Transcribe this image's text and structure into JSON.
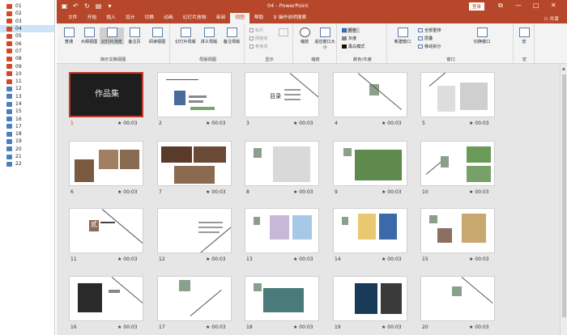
{
  "file_list": {
    "items": [
      {
        "label": "01",
        "type": "ppt"
      },
      {
        "label": "02",
        "type": "ppt"
      },
      {
        "label": "03",
        "type": "ppt"
      },
      {
        "label": "04",
        "type": "ppt",
        "selected": true
      },
      {
        "label": "05",
        "type": "ppt"
      },
      {
        "label": "06",
        "type": "ppt"
      },
      {
        "label": "07",
        "type": "ppt"
      },
      {
        "label": "08",
        "type": "ppt"
      },
      {
        "label": "09",
        "type": "ppt"
      },
      {
        "label": "10",
        "type": "ppt"
      },
      {
        "label": "11",
        "type": "ppt"
      },
      {
        "label": "12",
        "type": "img"
      },
      {
        "label": "13",
        "type": "img"
      },
      {
        "label": "14",
        "type": "img"
      },
      {
        "label": "15",
        "type": "img"
      },
      {
        "label": "16",
        "type": "img"
      },
      {
        "label": "17",
        "type": "img"
      },
      {
        "label": "18",
        "type": "img"
      },
      {
        "label": "19",
        "type": "img"
      },
      {
        "label": "20",
        "type": "img"
      },
      {
        "label": "21",
        "type": "img"
      },
      {
        "label": "22",
        "type": "img"
      }
    ]
  },
  "titlebar": {
    "title": "04 - PowerPoint",
    "login": "登录",
    "minimize": "—",
    "maximize": "□",
    "close": "✕",
    "ribbon_toggle": "⧉"
  },
  "tabs": [
    {
      "label": "文件"
    },
    {
      "label": "开始"
    },
    {
      "label": "插入"
    },
    {
      "label": "设计"
    },
    {
      "label": "切换"
    },
    {
      "label": "动画"
    },
    {
      "label": "幻灯片放映"
    },
    {
      "label": "审阅"
    },
    {
      "label": "视图",
      "active": true
    },
    {
      "label": "帮助"
    }
  ],
  "tell_me": "操作说明搜索",
  "share": "共享",
  "ribbon": {
    "presentation_views": {
      "label": "演示文稿视图",
      "buttons": [
        "普通",
        "大纲视图",
        "幻灯片浏览",
        "备注页",
        "阅读视图"
      ]
    },
    "master_views": {
      "label": "母版视图",
      "buttons": [
        "幻灯片母版",
        "讲义母版",
        "备注母版"
      ]
    },
    "show": {
      "label": "显示",
      "items": [
        "标尺",
        "网格线",
        "参考线"
      ]
    },
    "zoom": {
      "label": "缩放",
      "buttons": [
        "缩放",
        "适应窗口大小"
      ]
    },
    "color": {
      "label": "颜色/灰度",
      "items": [
        "颜色",
        "灰度",
        "黑白模式"
      ]
    },
    "window": {
      "label": "窗口",
      "items": [
        "新建窗口",
        "全部重排",
        "层叠",
        "移动拆分",
        "切换窗口"
      ]
    },
    "macro": {
      "label": "宏",
      "buttons": [
        "宏"
      ]
    }
  },
  "slides": [
    {
      "num": "1",
      "time": "00:03",
      "title": "作品集"
    },
    {
      "num": "2",
      "time": "00:03"
    },
    {
      "num": "3",
      "time": "00:03",
      "title": "目录"
    },
    {
      "num": "4",
      "time": "00:03"
    },
    {
      "num": "5",
      "time": "00:03"
    },
    {
      "num": "6",
      "time": "00:03"
    },
    {
      "num": "7",
      "time": "00:03"
    },
    {
      "num": "8",
      "time": "00:03"
    },
    {
      "num": "9",
      "time": "00:03"
    },
    {
      "num": "10",
      "time": "00:03"
    },
    {
      "num": "11",
      "time": "00:03",
      "title": "贰"
    },
    {
      "num": "12",
      "time": "00:03"
    },
    {
      "num": "13",
      "time": "00:03"
    },
    {
      "num": "14",
      "time": "00:03"
    },
    {
      "num": "15",
      "time": "00:03"
    },
    {
      "num": "16",
      "time": "00:03"
    },
    {
      "num": "17",
      "time": "00:03"
    },
    {
      "num": "18",
      "time": "00:03"
    },
    {
      "num": "19",
      "time": "00:03"
    },
    {
      "num": "20",
      "time": "00:03"
    }
  ],
  "colors": {
    "accent": "#b7472a",
    "selection": "#c0392b",
    "sage": "#8aa08a"
  }
}
